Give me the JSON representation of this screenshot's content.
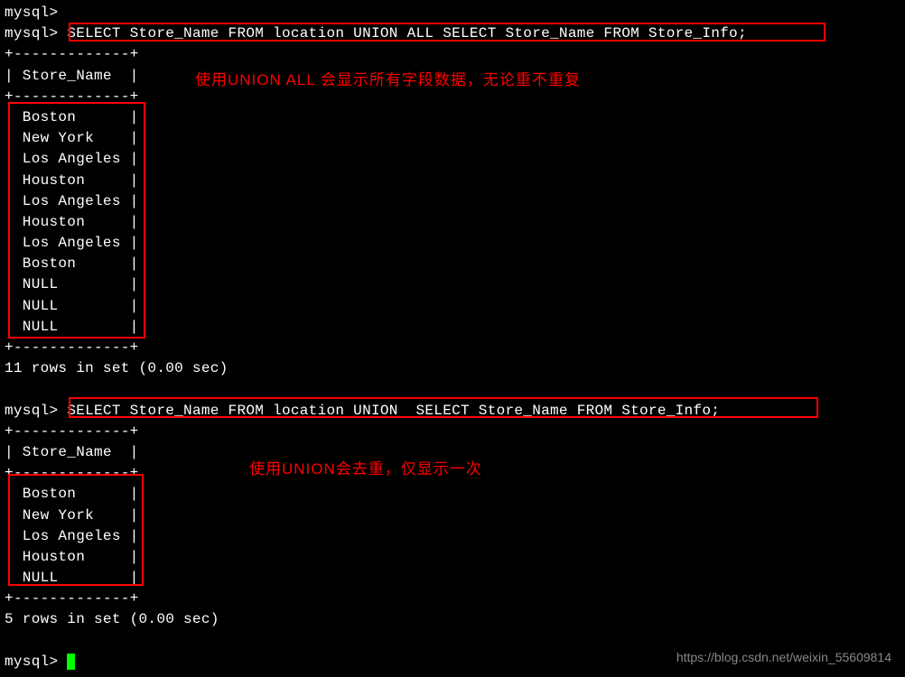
{
  "prompt": "mysql>",
  "query1": "SELECT Store_Name FROM location UNION ALL SELECT Store_Name FROM Store_Info;",
  "query2": "SELECT Store_Name FROM location UNION  SELECT Store_Name FROM Store_Info;",
  "separator": "+-------------+",
  "header_row": "| Store_Name  |",
  "table1_rows": [
    "| Boston      |",
    "| New York    |",
    "| Los Angeles |",
    "| Houston     |",
    "| Los Angeles |",
    "| Houston     |",
    "| Los Angeles |",
    "| Boston      |",
    "| NULL        |",
    "| NULL        |",
    "| NULL        |"
  ],
  "table2_rows": [
    "| Boston      |",
    "| New York    |",
    "| Los Angeles |",
    "| Houston     |",
    "| NULL        |"
  ],
  "result1": "11 rows in set (0.00 sec)",
  "result2": "5 rows in set (0.00 sec)",
  "annotation1": "使用UNION ALL 会显示所有字段数据，无论重不重复",
  "annotation2": "使用UNION会去重，仅显示一次",
  "watermark": "https://blog.csdn.net/weixin_55609814"
}
